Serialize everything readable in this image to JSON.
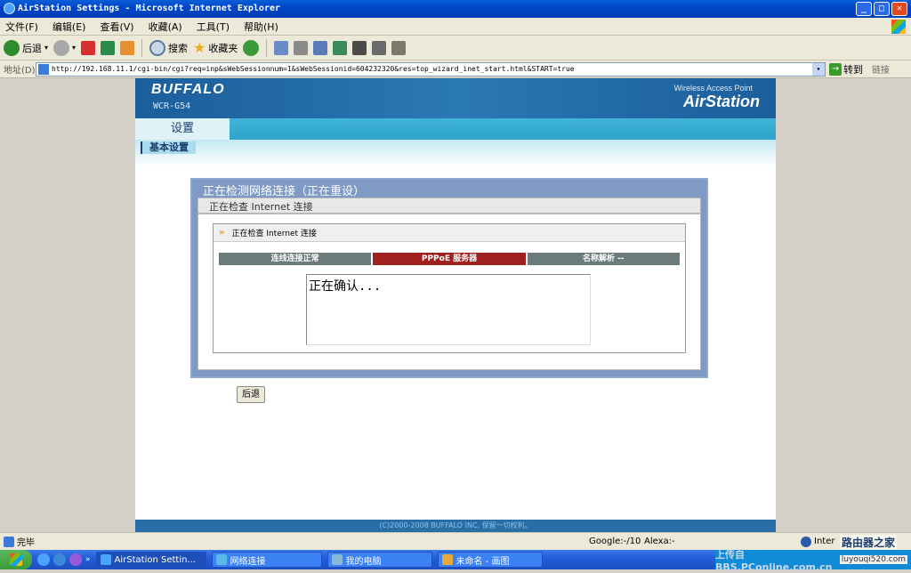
{
  "window": {
    "title": "AirStation Settings - Microsoft Internet Explorer",
    "min": "_",
    "max": "□",
    "close": "✕"
  },
  "menu": [
    "文件(F)",
    "编辑(E)",
    "查看(V)",
    "收藏(A)",
    "工具(T)",
    "帮助(H)"
  ],
  "toolbar": {
    "back": "后退",
    "search": "搜索",
    "favorites": "收藏夹"
  },
  "address": {
    "label": "地址(D)",
    "url": "http://192.168.11.1/cgi-bin/cgi?req=inp&sWebSessionnum=1&sWebSessionid=604232320&res=top_wizard_inet_start.html&START=true",
    "go": "转到",
    "links": "链接"
  },
  "page": {
    "brand": "BUFFALO",
    "model": "WCR-G54",
    "product_tag": "Wireless Access Point",
    "product_name": "AirStation",
    "tab": "设置",
    "subtab": "基本设置",
    "box_title": "正在检测网络连接（正在重设）",
    "box_subtitle": "正在检查 Internet 连接",
    "panel_title": "正在检查 Internet 连接",
    "steps": [
      {
        "label": "连线连接正常",
        "color": "#6b7b7b"
      },
      {
        "label": "PPPoE 服务器",
        "color": "#a02020"
      },
      {
        "label": "名称解析 --",
        "color": "#6b7b7b"
      }
    ],
    "message": "正在确认...",
    "back_button": "后退",
    "footer": "(C)2000-2008 BUFFALO INC. 保留一切权利。"
  },
  "status": {
    "text": "完毕",
    "google": "Google:-/10",
    "alexa": "Alexa:-",
    "zone": "Inter"
  },
  "taskbar": {
    "tasks": [
      "AirStation Settin...",
      "网络连接",
      "我的电脑",
      "未命名 - 画图"
    ],
    "watermark": "上传自BBS.PConline.com.cn",
    "site": "luyouqi520.com",
    "corner_mark": "路由器之家"
  }
}
